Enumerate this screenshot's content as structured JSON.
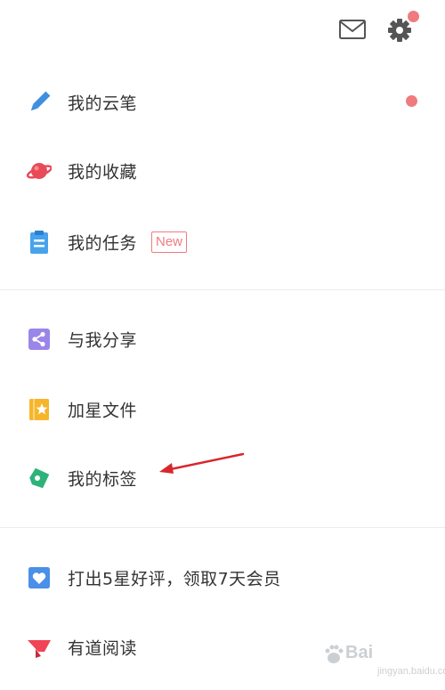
{
  "header": {
    "mail_icon": "mail-icon",
    "settings_icon": "gear-icon",
    "settings_has_badge": true
  },
  "sections": [
    {
      "items": [
        {
          "label": "我的云笔",
          "icon": "pencil-icon",
          "icon_color": "#3d8fe0",
          "badge_dot": true
        },
        {
          "label": "我的收藏",
          "icon": "planet-icon",
          "icon_color": "#e94a58"
        },
        {
          "label": "我的任务",
          "icon": "clipboard-icon",
          "icon_color": "#47a3ec",
          "badge_text": "New"
        }
      ]
    },
    {
      "items": [
        {
          "label": "与我分享",
          "icon": "share-icon",
          "icon_color": "#9a86e8"
        },
        {
          "label": "加星文件",
          "icon": "star-file-icon",
          "icon_color": "#f6b62b"
        },
        {
          "label": "我的标签",
          "icon": "tag-icon",
          "icon_color": "#2db37a"
        }
      ]
    },
    {
      "items": [
        {
          "label": "打出5星好评，领取7天会员",
          "icon": "heart-card-icon",
          "icon_color": "#4a8fe8"
        },
        {
          "label": "有道阅读",
          "icon": "reading-icon",
          "icon_color": "#ef4557"
        }
      ]
    }
  ],
  "colors": {
    "badge_dot": "#ef7b7e",
    "annotation_arrow": "#d9262c",
    "divider": "#ececec"
  },
  "watermark": {
    "logo_text": "Bai",
    "sub_text": "jingyan.baidu.com"
  }
}
